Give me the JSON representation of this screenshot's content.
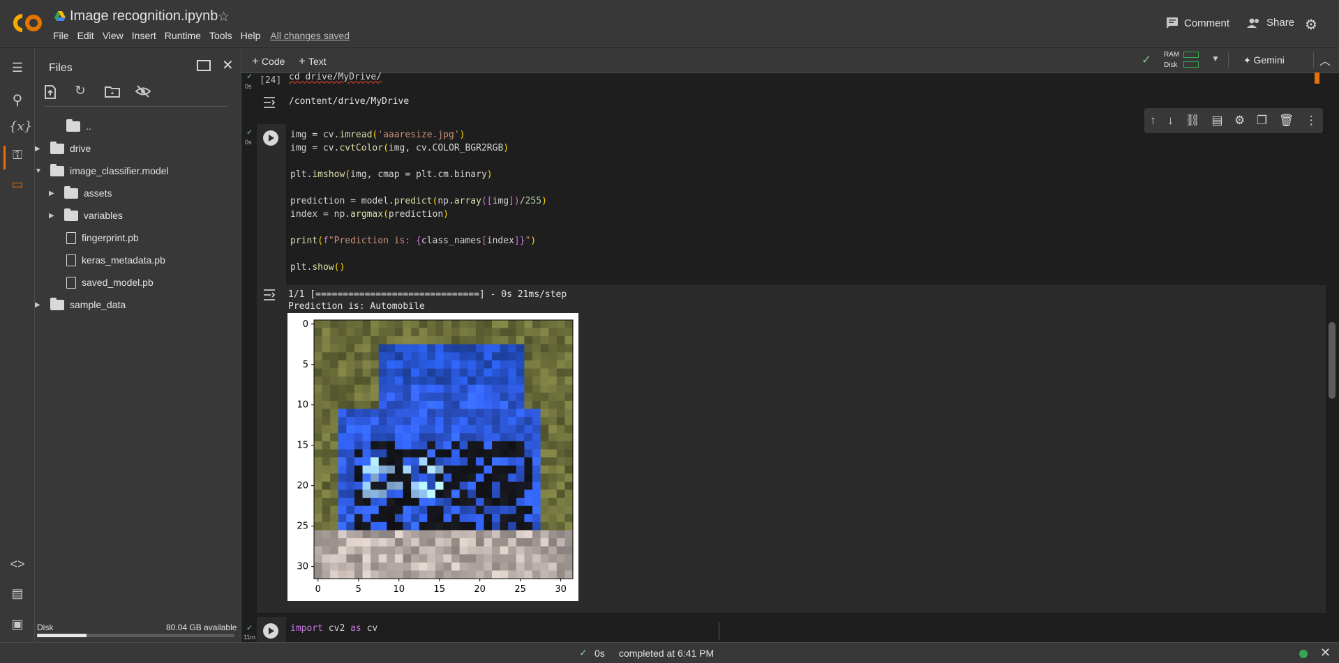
{
  "header": {
    "title": "Image recognition.ipynb",
    "menu": [
      "File",
      "Edit",
      "View",
      "Insert",
      "Runtime",
      "Tools",
      "Help"
    ],
    "saved_status": "All changes saved",
    "comment_label": "Comment",
    "share_label": "Share"
  },
  "toolbar": {
    "code_label": "Code",
    "text_label": "Text",
    "ram_label": "RAM",
    "disk_label": "Disk",
    "gemini_label": "Gemini"
  },
  "files": {
    "title": "Files",
    "tree": [
      {
        "label": "..",
        "kind": "up",
        "depth": 0
      },
      {
        "label": "drive",
        "kind": "folder",
        "depth": 0,
        "expanded": false
      },
      {
        "label": "image_classifier.model",
        "kind": "folder",
        "depth": 0,
        "expanded": true
      },
      {
        "label": "assets",
        "kind": "folder",
        "depth": 1,
        "expanded": false
      },
      {
        "label": "variables",
        "kind": "folder",
        "depth": 1,
        "expanded": false
      },
      {
        "label": "fingerprint.pb",
        "kind": "file",
        "depth": 1
      },
      {
        "label": "keras_metadata.pb",
        "kind": "file",
        "depth": 1
      },
      {
        "label": "saved_model.pb",
        "kind": "file",
        "depth": 1
      },
      {
        "label": "sample_data",
        "kind": "folder",
        "depth": 0,
        "expanded": false
      }
    ],
    "disk_label": "Disk",
    "disk_available": "80.04 GB available",
    "disk_used_fraction": 0.25
  },
  "cells": {
    "cell1": {
      "exec_count": "[24]",
      "time": "0s",
      "code": "cd drive/MyDrive/",
      "output": "/content/drive/MyDrive"
    },
    "cell2": {
      "time": "0s",
      "output_line1": "1/1 [==============================] - 0s 21ms/step",
      "output_line2": "Prediction is: Automobile"
    },
    "cell3": {
      "time": "11m",
      "code": "import cv2 as cv"
    }
  },
  "status": {
    "secs": "0s",
    "completed": "completed at 6:41 PM"
  },
  "chart_data": {
    "type": "heatmap",
    "title": "",
    "xlabel": "",
    "ylabel": "",
    "xticks": [
      0,
      5,
      10,
      15,
      20,
      25,
      30
    ],
    "yticks": [
      0,
      5,
      10,
      15,
      20,
      25,
      30
    ],
    "xlim": [
      -0.5,
      31.5
    ],
    "ylim": [
      31.5,
      -0.5
    ],
    "grid": false,
    "image_size": [
      32,
      32
    ],
    "colors": {
      "background_olive": "#6b6e3a",
      "car_blue": "#2f5be0",
      "dark": "#15161c",
      "light_blue": "#9fd0ff",
      "ground": "#b8ada8"
    }
  }
}
